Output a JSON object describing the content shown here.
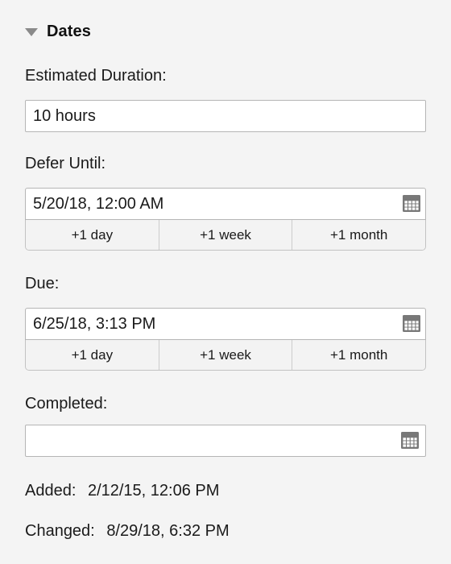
{
  "section": {
    "title": "Dates",
    "disclosure_state": "expanded",
    "disclosure_icon": "triangle-down-icon"
  },
  "fields": {
    "estimated_duration": {
      "label": "Estimated Duration:",
      "value": "10 hours",
      "placeholder": ""
    },
    "defer_until": {
      "label": "Defer Until:",
      "value": "5/20/18, 12:00 AM",
      "placeholder": "",
      "calendar_icon": "calendar-icon",
      "quick_buttons": [
        "+1 day",
        "+1 week",
        "+1 month"
      ]
    },
    "due": {
      "label": "Due:",
      "value": "6/25/18, 3:13 PM",
      "placeholder": "",
      "calendar_icon": "calendar-icon",
      "quick_buttons": [
        "+1 day",
        "+1 week",
        "+1 month"
      ]
    },
    "completed": {
      "label": "Completed:",
      "value": "",
      "placeholder": "",
      "calendar_icon": "calendar-icon"
    }
  },
  "meta": {
    "added": {
      "key": "Added:",
      "value": "2/12/15, 12:06 PM"
    },
    "changed": {
      "key": "Changed:",
      "value": "8/29/18, 6:32 PM"
    }
  },
  "colors": {
    "background": "#f4f4f4",
    "field_background": "#ffffff",
    "field_border": "#b5b5b5",
    "segment_background": "#f3f3f3",
    "segment_border": "#c2c2c2",
    "text": "#1a1a1a",
    "icon_gray": "#787878",
    "disclosure_gray": "#8a8a8a"
  }
}
